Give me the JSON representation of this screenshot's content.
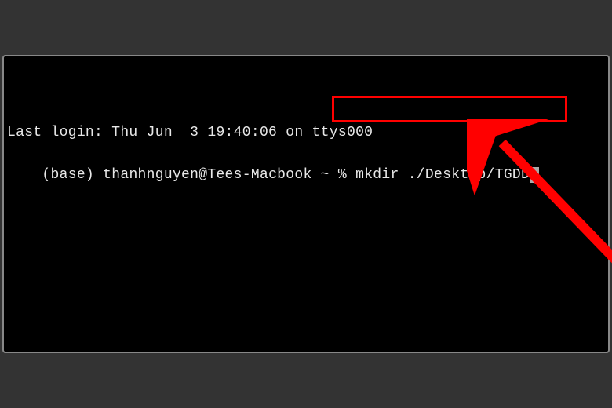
{
  "terminal": {
    "last_login_line": "Last login: Thu Jun  3 19:40:06 on ttys000",
    "prompt_prefix": "(base) thanhnguyen@Tees-Macbook ~ % ",
    "command": "mkdir ./Desktop/TGDD"
  },
  "annotation": {
    "highlight_color": "#ff0000",
    "arrow_color": "#ff0000"
  }
}
